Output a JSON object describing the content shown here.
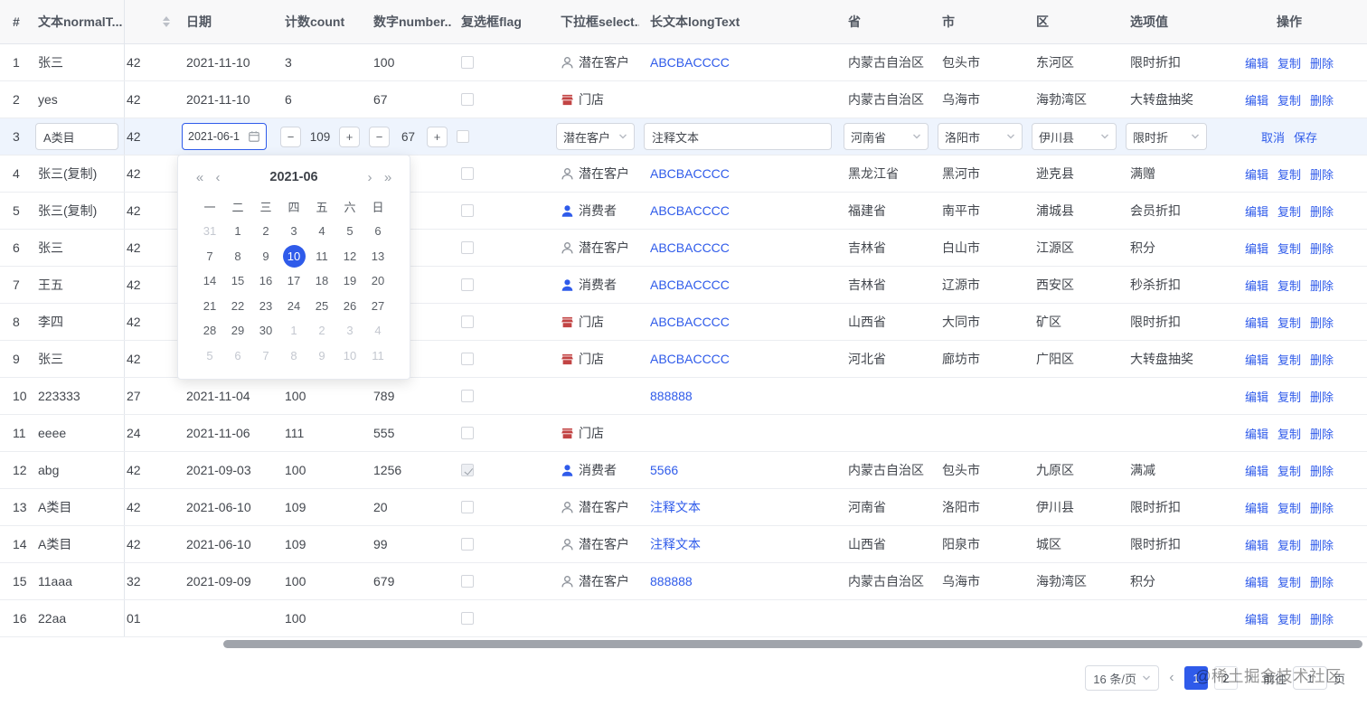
{
  "colors": {
    "accent": "#2f5bea",
    "shop_icon": "#c24444",
    "muted_icon": "#8d929a"
  },
  "header": {
    "columns": [
      {
        "key": "index",
        "label": "#"
      },
      {
        "key": "text",
        "label": "文本normalT..."
      },
      {
        "key": "hidden",
        "label": "",
        "sort": true
      },
      {
        "key": "date",
        "label": "日期"
      },
      {
        "key": "count",
        "label": "计数count"
      },
      {
        "key": "number",
        "label": "数字number..."
      },
      {
        "key": "flag",
        "label": "复选框flag"
      },
      {
        "key": "select",
        "label": "下拉框select..."
      },
      {
        "key": "longtext",
        "label": "长文本longText"
      },
      {
        "key": "province",
        "label": "省"
      },
      {
        "key": "city",
        "label": "市"
      },
      {
        "key": "district",
        "label": "区"
      },
      {
        "key": "option",
        "label": "选项值"
      },
      {
        "key": "actions",
        "label": "操作"
      }
    ]
  },
  "actions": {
    "normal": [
      "编辑",
      "复制",
      "删除"
    ],
    "editing": [
      "取消",
      "保存"
    ]
  },
  "rows": [
    {
      "index": "1",
      "text": "张三",
      "hidden": "42",
      "date": "2021-11-10",
      "count": "3",
      "number": "100",
      "checked": false,
      "select_icon": "user",
      "select_label": "潜在客户",
      "longtext": "ABCBACCCC",
      "province": "内蒙古自治区",
      "city": "包头市",
      "district": "东河区",
      "option": "限时折扣"
    },
    {
      "index": "2",
      "text": "yes",
      "hidden": "42",
      "date": "2021-11-10",
      "count": "6",
      "number": "67",
      "checked": false,
      "select_icon": "shop",
      "select_label": "门店",
      "longtext": "",
      "province": "内蒙古自治区",
      "city": "乌海市",
      "district": "海勃湾区",
      "option": "大转盘抽奖"
    },
    {
      "index": "3",
      "editing": true,
      "hidden": "42",
      "edit": {
        "text": "A类目",
        "date": "2021-06-1",
        "count": "109",
        "number": "67",
        "select": "潜在客户",
        "longtext": "注释文本",
        "province": "河南省",
        "city": "洛阳市",
        "district": "伊川县",
        "option": "限时折"
      }
    },
    {
      "index": "4",
      "text": "张三(复制)",
      "hidden": "42",
      "date": "",
      "count": "",
      "number": "",
      "checked": false,
      "select_icon": "user",
      "select_label": "潜在客户",
      "longtext": "ABCBACCCC",
      "province": "黑龙江省",
      "city": "黑河市",
      "district": "逊克县",
      "option": "满赠"
    },
    {
      "index": "5",
      "text": "张三(复制)",
      "hidden": "42",
      "date": "",
      "count": "",
      "number": "",
      "checked": false,
      "select_icon": "user-filled",
      "select_label": "消费者",
      "longtext": "ABCBACCCC",
      "province": "福建省",
      "city": "南平市",
      "district": "浦城县",
      "option": "会员折扣"
    },
    {
      "index": "6",
      "text": "张三",
      "hidden": "42",
      "date": "",
      "count": "",
      "number": "",
      "checked": false,
      "select_icon": "user",
      "select_label": "潜在客户",
      "longtext": "ABCBACCCC",
      "province": "吉林省",
      "city": "白山市",
      "district": "江源区",
      "option": "积分"
    },
    {
      "index": "7",
      "text": "王五",
      "hidden": "42",
      "date": "",
      "count": "",
      "number": "",
      "checked": false,
      "select_icon": "user-filled",
      "select_label": "消费者",
      "longtext": "ABCBACCCC",
      "province": "吉林省",
      "city": "辽源市",
      "district": "西安区",
      "option": "秒杀折扣"
    },
    {
      "index": "8",
      "text": "李四",
      "hidden": "42",
      "date": "",
      "count": "",
      "number": "",
      "checked": false,
      "select_icon": "shop",
      "select_label": "门店",
      "longtext": "ABCBACCCC",
      "province": "山西省",
      "city": "大同市",
      "district": "矿区",
      "option": "限时折扣"
    },
    {
      "index": "9",
      "text": "张三",
      "hidden": "42",
      "date": "",
      "count": "",
      "number": "",
      "checked": false,
      "select_icon": "shop",
      "select_label": "门店",
      "longtext": "ABCBACCCC",
      "province": "河北省",
      "city": "廊坊市",
      "district": "广阳区",
      "option": "大转盘抽奖"
    },
    {
      "index": "10",
      "text": "223333",
      "hidden": "27",
      "date": "2021-11-04",
      "count": "100",
      "number": "789",
      "checked": false,
      "select_icon": "",
      "select_label": "",
      "longtext": "888888",
      "province": "",
      "city": "",
      "district": "",
      "option": ""
    },
    {
      "index": "11",
      "text": "eeee",
      "hidden": "24",
      "date": "2021-11-06",
      "count": "111",
      "number": "555",
      "checked": false,
      "select_icon": "shop",
      "select_label": "门店",
      "longtext": "",
      "province": "",
      "city": "",
      "district": "",
      "option": ""
    },
    {
      "index": "12",
      "text": "abg",
      "hidden": "42",
      "date": "2021-09-03",
      "count": "100",
      "number": "1256",
      "checked": true,
      "checkbox_disabled": true,
      "select_icon": "user-filled",
      "select_label": "消费者",
      "longtext": "5566",
      "province": "内蒙古自治区",
      "city": "包头市",
      "district": "九原区",
      "option": "满减"
    },
    {
      "index": "13",
      "text": "A类目",
      "hidden": "42",
      "date": "2021-06-10",
      "count": "109",
      "number": "20",
      "checked": false,
      "select_icon": "user",
      "select_label": "潜在客户",
      "longtext": "注释文本",
      "province": "河南省",
      "city": "洛阳市",
      "district": "伊川县",
      "option": "限时折扣"
    },
    {
      "index": "14",
      "text": "A类目",
      "hidden": "42",
      "date": "2021-06-10",
      "count": "109",
      "number": "99",
      "checked": false,
      "select_icon": "user",
      "select_label": "潜在客户",
      "longtext": "注释文本",
      "province": "山西省",
      "city": "阳泉市",
      "district": "城区",
      "option": "限时折扣"
    },
    {
      "index": "15",
      "text": "11aaa",
      "hidden": "32",
      "date": "2021-09-09",
      "count": "100",
      "number": "679",
      "checked": false,
      "select_icon": "user",
      "select_label": "潜在客户",
      "longtext": "888888",
      "province": "内蒙古自治区",
      "city": "乌海市",
      "district": "海勃湾区",
      "option": "积分"
    },
    {
      "index": "16",
      "text": "22aa",
      "hidden": "01",
      "date": "",
      "count": "100",
      "number": "",
      "checked": false,
      "select_icon": "",
      "select_label": "",
      "longtext": "",
      "province": "",
      "city": "",
      "district": "",
      "option": ""
    }
  ],
  "calendar": {
    "prev_year_icon": "«",
    "prev_month_icon": "‹",
    "next_month_icon": "›",
    "next_year_icon": "»",
    "title": "2021-06",
    "day_names": [
      "一",
      "二",
      "三",
      "四",
      "五",
      "六",
      "日"
    ],
    "weeks": [
      [
        {
          "d": "31",
          "m": 1
        },
        {
          "d": "1"
        },
        {
          "d": "2"
        },
        {
          "d": "3"
        },
        {
          "d": "4"
        },
        {
          "d": "5"
        },
        {
          "d": "6"
        }
      ],
      [
        {
          "d": "7"
        },
        {
          "d": "8"
        },
        {
          "d": "9"
        },
        {
          "d": "10",
          "s": 1
        },
        {
          "d": "11"
        },
        {
          "d": "12"
        },
        {
          "d": "13"
        }
      ],
      [
        {
          "d": "14"
        },
        {
          "d": "15"
        },
        {
          "d": "16"
        },
        {
          "d": "17"
        },
        {
          "d": "18"
        },
        {
          "d": "19"
        },
        {
          "d": "20"
        }
      ],
      [
        {
          "d": "21"
        },
        {
          "d": "22"
        },
        {
          "d": "23"
        },
        {
          "d": "24"
        },
        {
          "d": "25"
        },
        {
          "d": "26"
        },
        {
          "d": "27"
        }
      ],
      [
        {
          "d": "28"
        },
        {
          "d": "29"
        },
        {
          "d": "30"
        },
        {
          "d": "1",
          "m": 1
        },
        {
          "d": "2",
          "m": 1
        },
        {
          "d": "3",
          "m": 1
        },
        {
          "d": "4",
          "m": 1
        }
      ],
      [
        {
          "d": "5",
          "m": 1
        },
        {
          "d": "6",
          "m": 1
        },
        {
          "d": "7",
          "m": 1
        },
        {
          "d": "8",
          "m": 1
        },
        {
          "d": "9",
          "m": 1
        },
        {
          "d": "10",
          "m": 1
        },
        {
          "d": "11",
          "m": 1
        }
      ]
    ]
  },
  "pagination": {
    "page_size": "16 条/页",
    "prev_icon": "‹",
    "next_icon": "›",
    "pages": [
      "1",
      "2"
    ],
    "active_page": "1",
    "jump_label": "前往",
    "jump_value": "1",
    "jump_unit": "页"
  },
  "watermark": "@稀土掘金技术社区"
}
